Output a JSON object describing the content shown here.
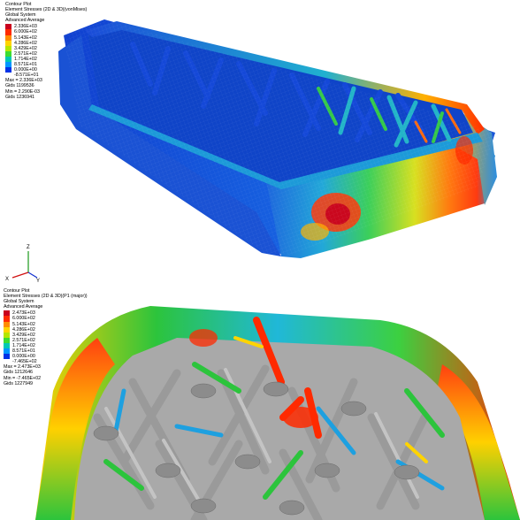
{
  "plots": [
    {
      "header": [
        "Contour Plot",
        "Element Stresses (2D & 3D)(vonMises)",
        "Global System",
        "Advanced Average"
      ],
      "scale": [
        {
          "label": "2.336E+03",
          "color": "#c8001e"
        },
        {
          "label": "6.000E+02",
          "color": "#ff2a00"
        },
        {
          "label": "5.143E+02",
          "color": "#ff8c00"
        },
        {
          "label": "4.286E+02",
          "color": "#ffd400"
        },
        {
          "label": "3.429E+02",
          "color": "#b4e600"
        },
        {
          "label": "2.571E+02",
          "color": "#3cdc32"
        },
        {
          "label": "1.714E+02",
          "color": "#00c8b4"
        },
        {
          "label": "8.571E+01",
          "color": "#0096ff"
        },
        {
          "label": "0.000E+00",
          "color": "#0032e6"
        },
        {
          "label": "-8.571E+01",
          "color": null
        }
      ],
      "stats": [
        "Max = 2.336E+03",
        "Gids 1199536",
        "Min = 2.290E-03",
        "Gids 1236941"
      ]
    },
    {
      "header": [
        "Contour Plot",
        "Element Stresses (2D & 3D)(P1 (major))",
        "Global System",
        "Advanced Average"
      ],
      "scale": [
        {
          "label": "2.473E+03",
          "color": "#c8001e"
        },
        {
          "label": "6.000E+02",
          "color": "#ff2a00"
        },
        {
          "label": "5.143E+02",
          "color": "#ff8c00"
        },
        {
          "label": "4.286E+02",
          "color": "#ffd400"
        },
        {
          "label": "3.429E+02",
          "color": "#b4e600"
        },
        {
          "label": "2.571E+02",
          "color": "#3cdc32"
        },
        {
          "label": "1.714E+02",
          "color": "#00c8b4"
        },
        {
          "label": "8.571E+01",
          "color": "#0096ff"
        },
        {
          "label": "0.000E+00",
          "color": "#0032e6"
        },
        {
          "label": "-7.465E+02",
          "color": null
        }
      ],
      "stats": [
        "Max = 2.473E+03",
        "Gids 1212646",
        "Min = -7.465E+02",
        "Gids 1227949"
      ]
    }
  ],
  "triad": {
    "z": "Z",
    "x": "X",
    "y": "Y"
  },
  "colors": {
    "model_gray": "#a9a9a9",
    "high_stress": "#e81c00",
    "low_stress": "#1238c8"
  }
}
